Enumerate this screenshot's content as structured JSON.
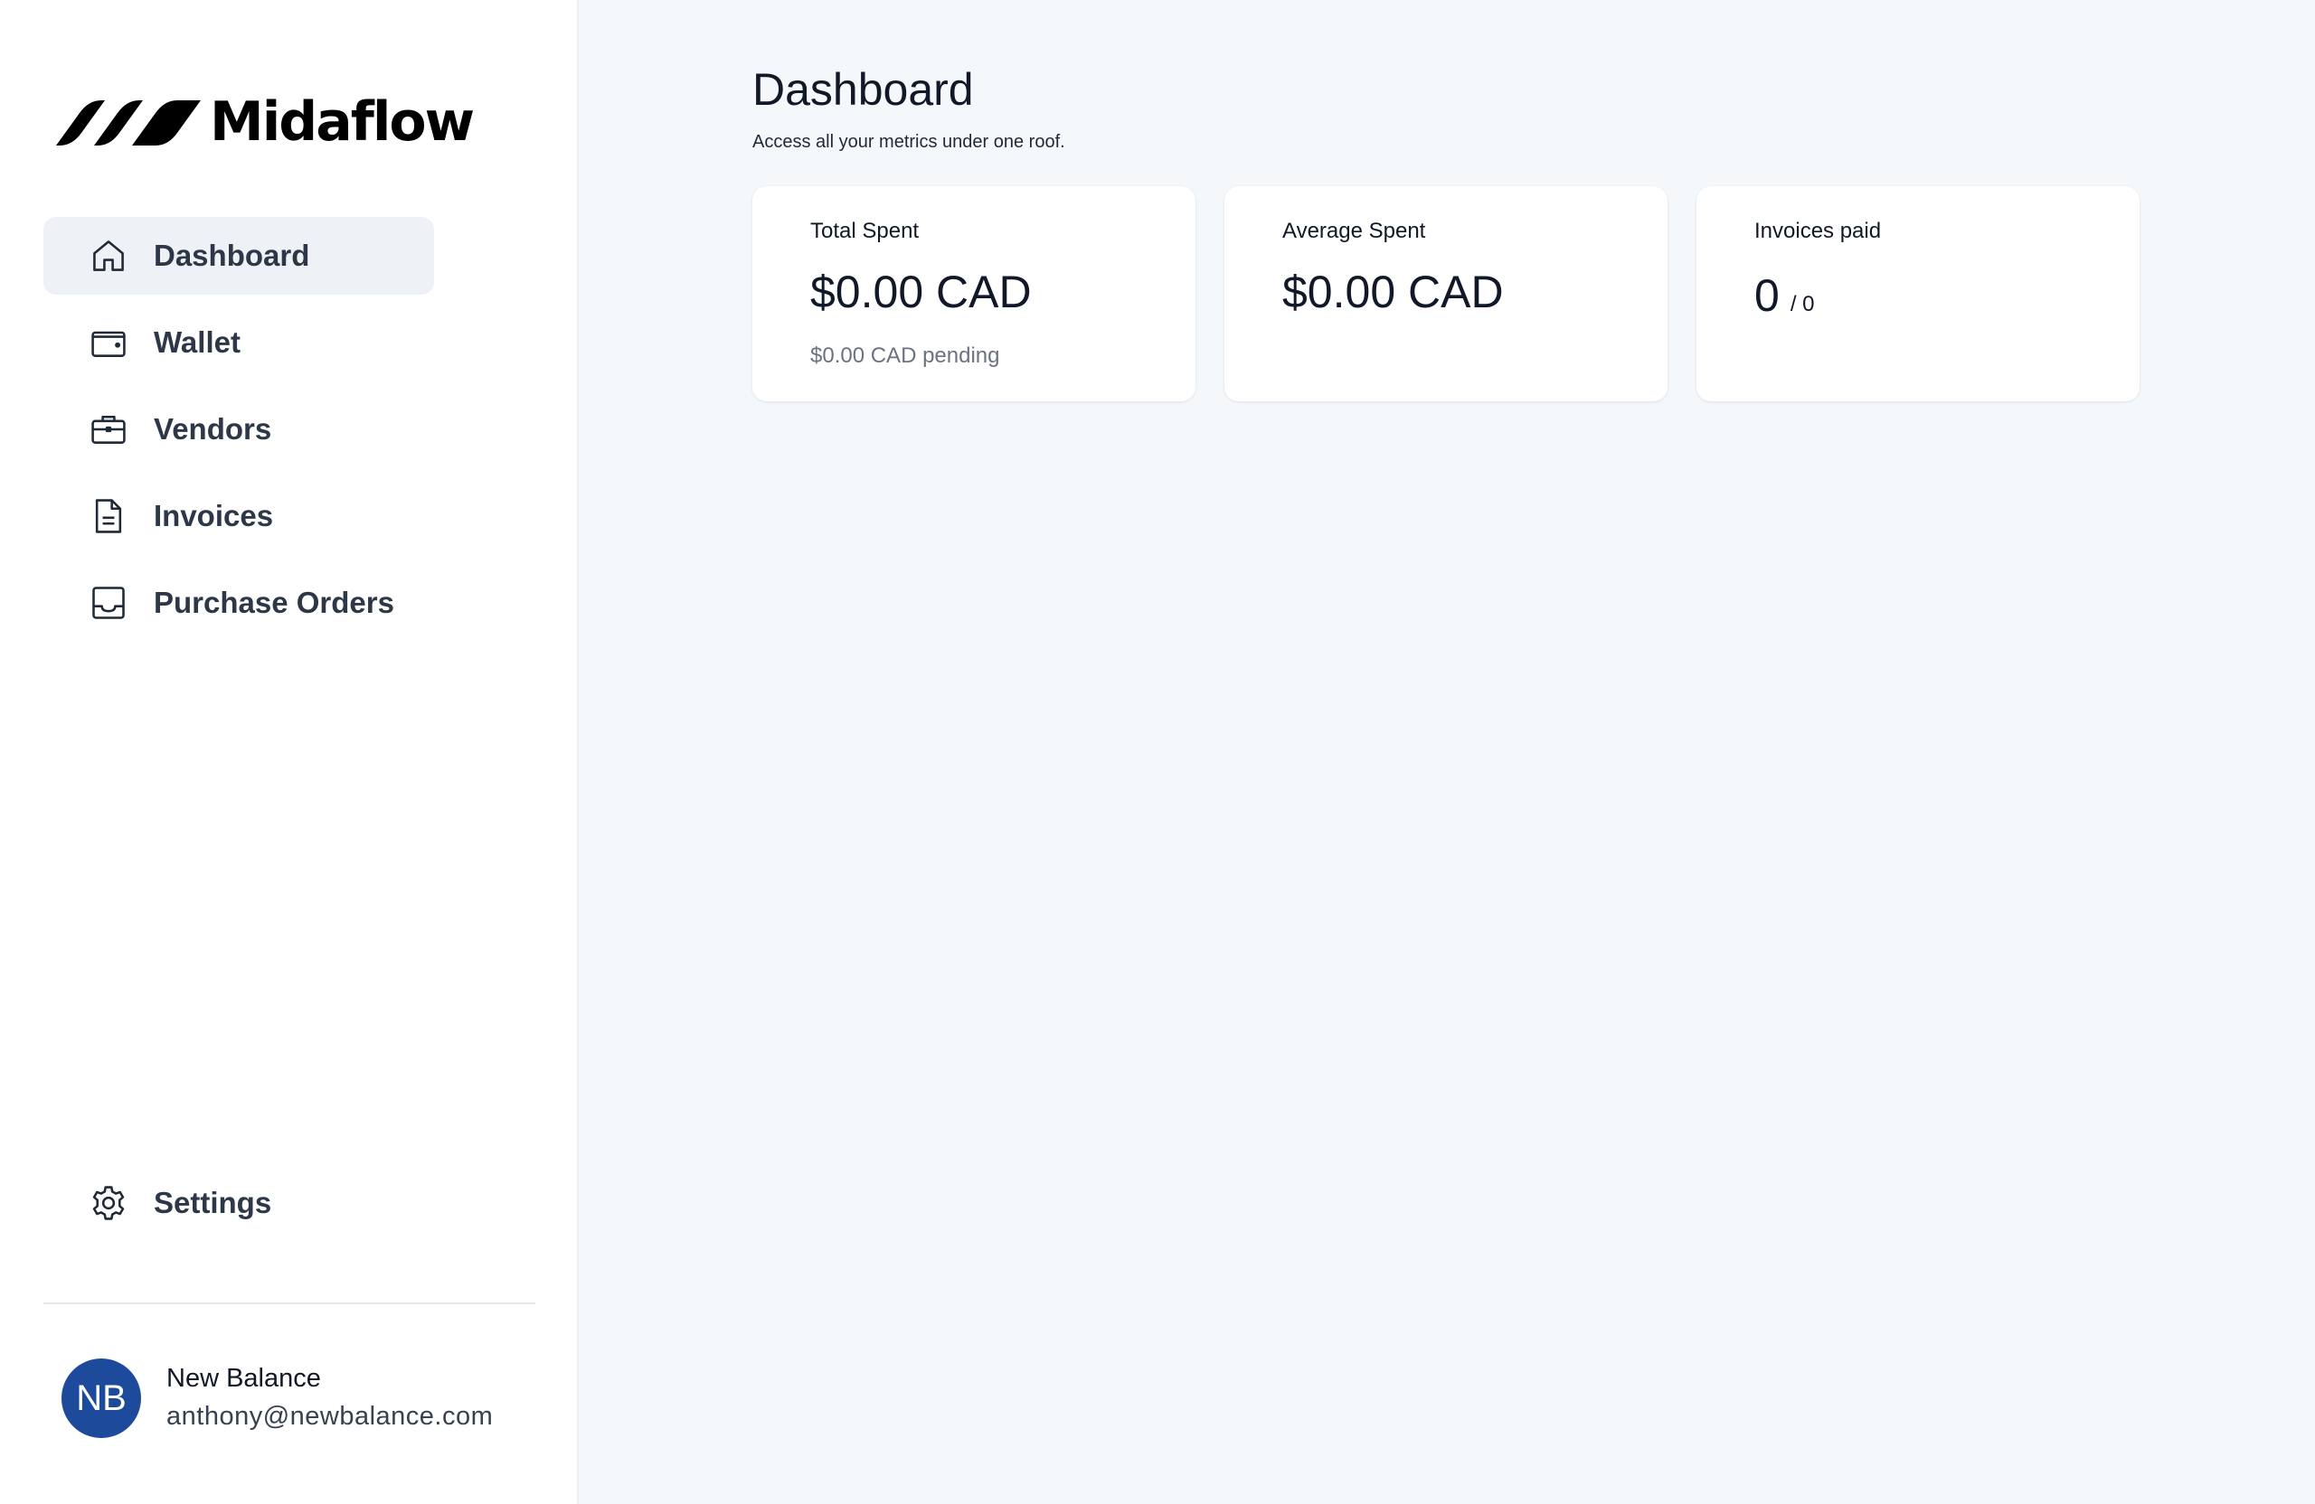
{
  "brand": {
    "name": "Midaflow",
    "logo_icon": "stripes-logo-icon"
  },
  "sidebar": {
    "items": [
      {
        "label": "Dashboard",
        "icon": "home-icon",
        "active": true
      },
      {
        "label": "Wallet",
        "icon": "wallet-icon",
        "active": false
      },
      {
        "label": "Vendors",
        "icon": "briefcase-icon",
        "active": false
      },
      {
        "label": "Invoices",
        "icon": "document-icon",
        "active": false
      },
      {
        "label": "Purchase Orders",
        "icon": "inbox-icon",
        "active": false
      }
    ],
    "settings": {
      "label": "Settings",
      "icon": "gear-icon"
    }
  },
  "user": {
    "initials": "NB",
    "name": "New Balance",
    "email": "anthony@newbalance.com",
    "avatar_color": "#1d4a9b"
  },
  "main": {
    "title": "Dashboard",
    "subtitle": "Access all your metrics under one roof.",
    "cards": [
      {
        "label": "Total Spent",
        "value": "$0.00 CAD",
        "sub": "$0.00 CAD pending"
      },
      {
        "label": "Average Spent",
        "value": "$0.00 CAD"
      },
      {
        "label": "Invoices paid",
        "count": "0",
        "count_total": "/ 0"
      }
    ]
  },
  "colors": {
    "background": "#f5f8fb",
    "active_nav": "#eef1f5",
    "text": "#111827",
    "muted": "#6b7280"
  }
}
